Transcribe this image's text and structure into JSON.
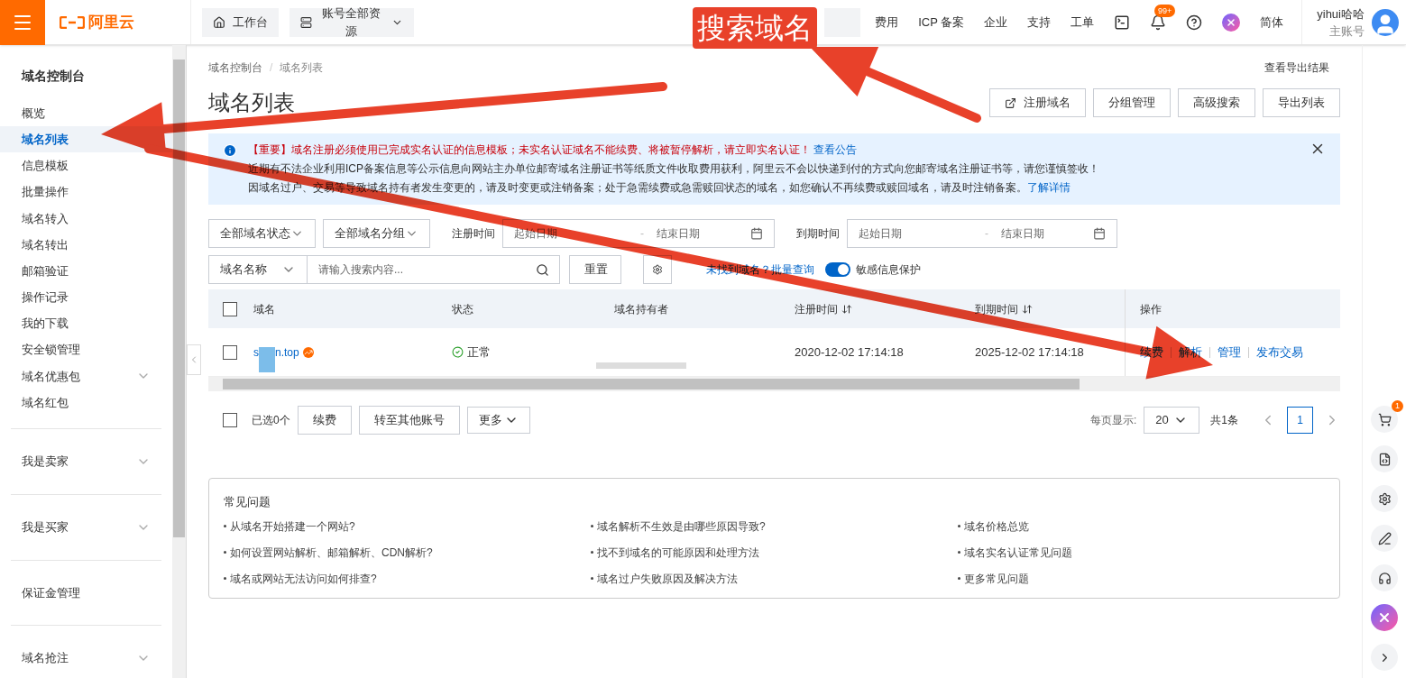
{
  "topbar": {
    "logo": "阿里云",
    "workbench": "工作台",
    "resources": "账号全部资源",
    "links": [
      "费用",
      "ICP 备案",
      "企业",
      "支持",
      "工单"
    ],
    "notification_badge": "99+",
    "language": "简体",
    "user": "yihui哈哈",
    "account_type": "主账号"
  },
  "sidebar": {
    "title": "域名控制台",
    "items": [
      {
        "label": "概览",
        "selected": false,
        "expandable": false
      },
      {
        "label": "域名列表",
        "selected": true,
        "expandable": false
      },
      {
        "label": "信息模板",
        "selected": false,
        "expandable": false
      },
      {
        "label": "批量操作",
        "selected": false,
        "expandable": false
      },
      {
        "label": "域名转入",
        "selected": false,
        "expandable": false
      },
      {
        "label": "域名转出",
        "selected": false,
        "expandable": false
      },
      {
        "label": "邮箱验证",
        "selected": false,
        "expandable": false
      },
      {
        "label": "操作记录",
        "selected": false,
        "expandable": false
      },
      {
        "label": "我的下载",
        "selected": false,
        "expandable": false
      },
      {
        "label": "安全锁管理",
        "selected": false,
        "expandable": false
      },
      {
        "label": "域名优惠包",
        "selected": false,
        "expandable": true
      },
      {
        "label": "域名红包",
        "selected": false,
        "expandable": false
      }
    ],
    "groups": [
      {
        "label": "我是卖家",
        "expandable": true
      },
      {
        "label": "我是买家",
        "expandable": true
      },
      {
        "label": "保证金管理",
        "expandable": false
      },
      {
        "label": "域名抢注",
        "expandable": true
      }
    ]
  },
  "breadcrumb": [
    "域名控制台",
    "/",
    "域名列表"
  ],
  "export_results": "查看导出结果",
  "page_title": "域名列表",
  "actions": [
    "注册域名",
    "分组管理",
    "高级搜索",
    "导出列表"
  ],
  "notice": {
    "lines": [
      "【重要】域名注册必须使用已完成实名认证的信息模板；未实名认证域名不能续费、将被暂停解析，请立即实名认证！",
      "近期有不法企业利用ICP备案信息等公示信息向网站主办单位邮寄域名注册证书等纸质文件收取费用获利，阿里云不会以快递到付的方式向您邮寄域名注册证书等，请您谨慎签收！",
      "因域名过户、交易等导致域名持有者发生变更的，请及时变更或注销备案；处于急需续费或急需赎回状态的域名，如您确认不再续费或赎回域名，请及时注销备案。"
    ],
    "links": [
      "查看公告",
      "了解详情"
    ]
  },
  "filters": {
    "status": "全部域名状态",
    "group": "全部域名分组",
    "reg_label": "注册时间",
    "reg_start": "起始日期",
    "range_separator": "-",
    "reg_end": "结束日期",
    "exp_label": "到期时间",
    "exp_start": "起始日期",
    "exp_end": "结束日期",
    "search_type": "域名名称",
    "search_placeholder": "请输入搜索内容...",
    "reset": "重置",
    "batch_link": "未找到域名？批量查询",
    "sensitive": {
      "label": "敏感信息保护",
      "on": true
    }
  },
  "table": {
    "select_all_checked": false,
    "columns": [
      "域名",
      "状态",
      "域名持有者",
      "注册时间",
      "到期时间",
      "操作"
    ],
    "rows": [
      {
        "checked": false,
        "domain_start": "s",
        "domain_end": "n.top",
        "status": "正常",
        "registered": "2020-12-02 17:14:18",
        "expires": "2025-12-02 17:14:18",
        "actions": [
          "续费",
          "解析",
          "管理",
          "发布交易"
        ]
      }
    ]
  },
  "footer": {
    "select_all_checked": false,
    "selected": "已选0个",
    "buttons": [
      "续费",
      "转至其他账号",
      "更多"
    ],
    "per_page_label": "每页显示:",
    "per_page": "20",
    "total": "共1条",
    "page": "1"
  },
  "faq": {
    "title": "常见问题",
    "items": [
      "从域名开始搭建一个网站?",
      "域名解析不生效是由哪些原因导致?",
      "域名价格总览",
      "如何设置网站解析、邮箱解析、CDN解析?",
      "找不到域名的可能原因和处理方法",
      "域名实名认证常见问题",
      "域名或网站无法访问如何排查?",
      "域名过户失败原因及解决方法",
      "更多常见问题"
    ]
  },
  "right_rail": {
    "cart_badge": "1"
  },
  "annotation": {
    "label": "搜索域名"
  }
}
